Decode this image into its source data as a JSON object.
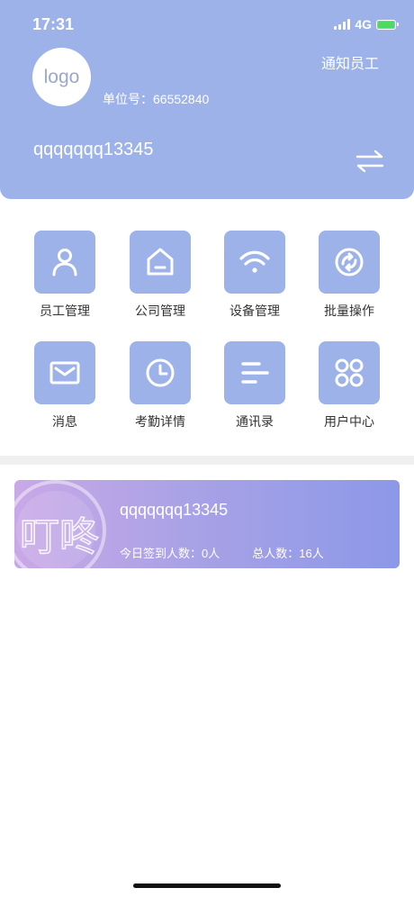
{
  "status_bar": {
    "time": "17:31",
    "network": "4G"
  },
  "header": {
    "logo_text": "logo",
    "unit_label": "单位号：",
    "unit_number": "66552840",
    "notify_label": "通知员工",
    "account_name": "qqqqqqq13345",
    "switch_icon": "swap-arrows-icon"
  },
  "colors": {
    "header_bg": "#9db2e8",
    "tile_bg": "#9db2e8",
    "battery_fill": "#4cd964"
  },
  "grid": {
    "items": [
      {
        "label": "员工管理",
        "icon": "person-icon"
      },
      {
        "label": "公司管理",
        "icon": "home-icon"
      },
      {
        "label": "设备管理",
        "icon": "wifi-icon"
      },
      {
        "label": "批量操作",
        "icon": "refresh-icon"
      },
      {
        "label": "消息",
        "icon": "mail-icon"
      },
      {
        "label": "考勤详情",
        "icon": "clock-icon"
      },
      {
        "label": "通讯录",
        "icon": "list-icon"
      },
      {
        "label": "用户中心",
        "icon": "apps-icon"
      }
    ]
  },
  "banner": {
    "logo_text": "叮咚",
    "name": "qqqqqqq13345",
    "today_checkin_label": "今日签到人数：0人",
    "total_label": "总人数：16人"
  }
}
